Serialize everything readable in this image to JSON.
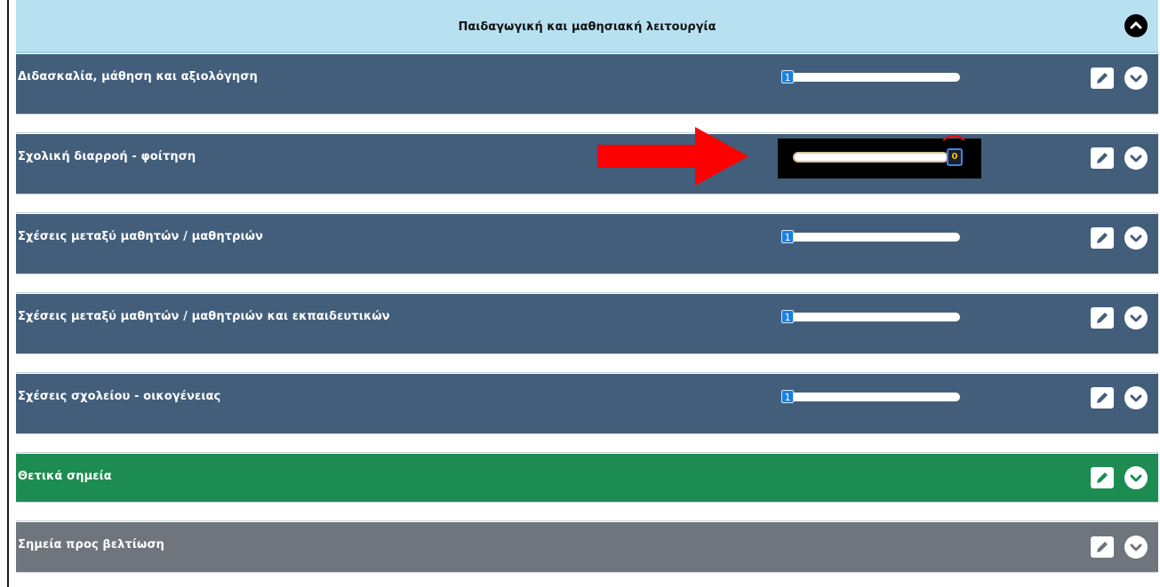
{
  "header": {
    "title": "Παιδαγωγική και μαθησιακή λειτουργία"
  },
  "sections": [
    {
      "label": "Διδασκαλία, μάθηση και αξιολόγηση",
      "slider_value": "1"
    },
    {
      "label": "Σχολική διαρροή - φοίτηση",
      "slider_value": "0"
    },
    {
      "label": "Σχέσεις μεταξύ μαθητών / μαθητριών",
      "slider_value": "1"
    },
    {
      "label": "Σχέσεις μεταξύ μαθητών / μαθητριών και εκπαιδευτικών",
      "slider_value": "1"
    },
    {
      "label": "Σχέσεις σχολείου - οικογένειας",
      "slider_value": "1"
    },
    {
      "label": "Θετικά σημεία"
    },
    {
      "label": "Σημεία προς βελτίωση"
    }
  ],
  "icons": {
    "edit": "pencil-icon",
    "expand": "chevron-down-icon",
    "collapse": "chevron-up-icon",
    "annotation": "red-arrow"
  },
  "colors": {
    "header_bg": "#b7e1f0",
    "section_blue": "#425e7a",
    "section_green": "#1c8c52",
    "section_gray": "#6f757c",
    "slider_thumb": "#1a7fe3",
    "arrow": "#ff0000"
  }
}
